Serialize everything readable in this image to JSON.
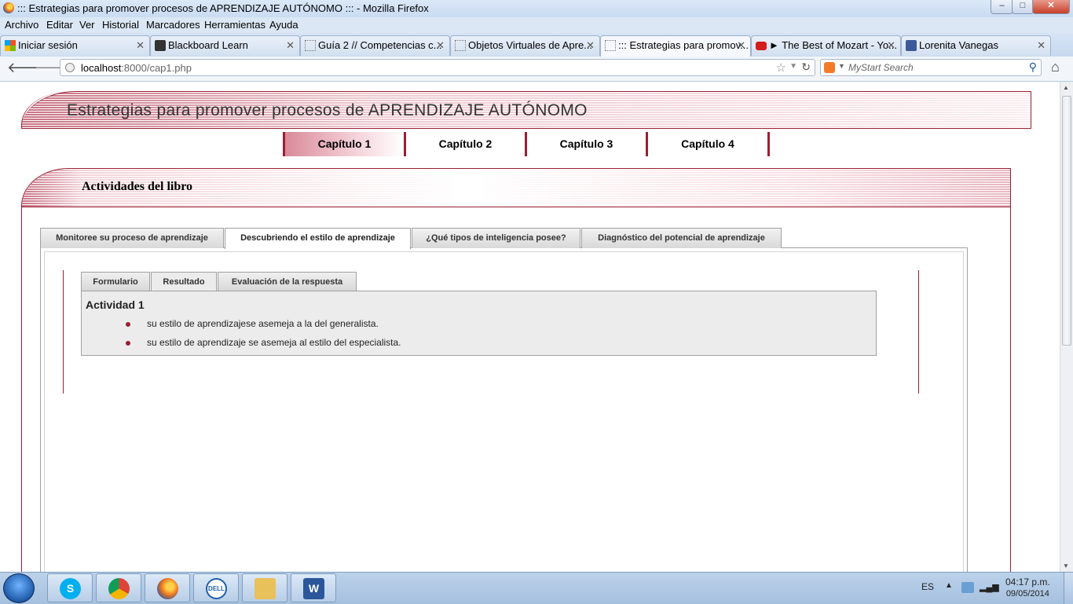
{
  "window": {
    "title": "::: Estrategias para promover procesos de APRENDIZAJE AUTÓNOMO ::: - Mozilla Firefox",
    "controls": {
      "minimize": "–",
      "maximize": "□",
      "close": "✕"
    }
  },
  "menu": [
    "Archivo",
    "Editar",
    "Ver",
    "Historial",
    "Marcadores",
    "Herramientas",
    "Ayuda"
  ],
  "tabs": [
    {
      "label": "Iniciar sesión",
      "icon": "windows-logo-icon"
    },
    {
      "label": "Blackboard Learn",
      "icon": "blackboard-icon"
    },
    {
      "label": "Guía 2 // Competencias c...",
      "icon": "blank-page-icon"
    },
    {
      "label": "Objetos Virtuales de Apre...",
      "icon": "blank-page-icon"
    },
    {
      "label": "::: Estrategias para promov...",
      "icon": "blank-page-icon",
      "active": true
    },
    {
      "label": "► The Best of Mozart - Yo...",
      "icon": "youtube-icon"
    },
    {
      "label": "Lorenita Vanegas",
      "icon": "facebook-icon"
    }
  ],
  "tab_close": "✕",
  "new_tab": "+",
  "nav": {
    "back": "🡐",
    "forward": "🡒",
    "url_host": "localhost",
    "url_path": ":8000/cap1.php",
    "search_placeholder": "MyStart Search",
    "home": "⌂"
  },
  "page": {
    "banner_title": "Estrategias para promover procesos de  APRENDIZAJE AUTÓNOMO",
    "chapters": [
      "Capítulo 1",
      "Capítulo 2",
      "Capítulo 3",
      "Capítulo 4"
    ],
    "active_chapter": "Capítulo 1",
    "panel_title": "Actividades del libro",
    "outer_tabs": [
      "Monitoree su proceso de aprendizaje",
      "Descubriendo el estilo de aprendizaje",
      "¿Qué tipos de inteligencia posee?",
      "Diagnóstico del potencial de aprendizaje"
    ],
    "active_outer_tab": "Descubriendo el estilo de aprendizaje",
    "inner_tabs": [
      "Formulario",
      "Resultado",
      "Evaluación de la respuesta"
    ],
    "active_inner_tab": "Resultado",
    "result": {
      "heading": "Actividad 1",
      "lines": [
        "su estilo de aprendizajese asemeja a la del generalista.",
        "su estilo de aprendizaje se asemeja al estilo del especialista."
      ]
    }
  },
  "taskbar": {
    "apps": [
      "skype-icon",
      "chrome-icon",
      "firefox-icon",
      "dell-icon",
      "file-explorer-icon",
      "word-icon"
    ],
    "language": "ES",
    "time": "04:17 p.m.",
    "date": "09/05/2014"
  },
  "colors": {
    "accent": "#9a1e34",
    "banner_gradient_start": "#c77383",
    "tab_gray": "#d9d9d9"
  }
}
